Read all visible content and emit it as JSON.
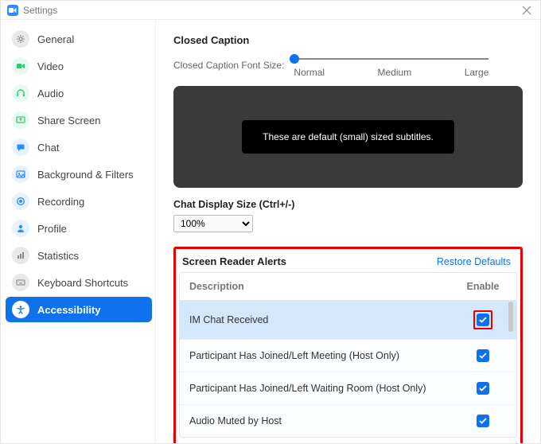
{
  "window": {
    "title": "Settings"
  },
  "sidebar": {
    "items": [
      {
        "label": "General",
        "icon": "gear-icon",
        "bg": "#e9e9e9",
        "fg": "#888"
      },
      {
        "label": "Video",
        "icon": "video-icon",
        "bg": "#e7faef",
        "fg": "#2ecc71"
      },
      {
        "label": "Audio",
        "icon": "headphones-icon",
        "bg": "#e7faef",
        "fg": "#2ecc71"
      },
      {
        "label": "Share Screen",
        "icon": "share-screen-icon",
        "bg": "#e7faef",
        "fg": "#2ecc71"
      },
      {
        "label": "Chat",
        "icon": "chat-icon",
        "bg": "#e7f2ff",
        "fg": "#2d8cff"
      },
      {
        "label": "Background & Filters",
        "icon": "background-icon",
        "bg": "#e7f2ff",
        "fg": "#2d8cff"
      },
      {
        "label": "Recording",
        "icon": "recording-icon",
        "bg": "#e7f2ff",
        "fg": "#2d8cff"
      },
      {
        "label": "Profile",
        "icon": "profile-icon",
        "bg": "#e7f2ff",
        "fg": "#2d8cff"
      },
      {
        "label": "Statistics",
        "icon": "stats-icon",
        "bg": "#e9e9e9",
        "fg": "#888"
      },
      {
        "label": "Keyboard Shortcuts",
        "icon": "keyboard-icon",
        "bg": "#e9e9e9",
        "fg": "#888"
      },
      {
        "label": "Accessibility",
        "icon": "accessibility-icon",
        "bg": "#ffffff",
        "fg": "#0e72ed",
        "active": true
      }
    ]
  },
  "caption": {
    "section_title": "Closed Caption",
    "font_label": "Closed Caption Font Size:",
    "ticks": [
      "Normal",
      "Medium",
      "Large"
    ],
    "preview_text": "These are default (small) sized subtitles."
  },
  "chat_size": {
    "label": "Chat Display Size (Ctrl+/-)",
    "value": "100%"
  },
  "alerts": {
    "title": "Screen Reader Alerts",
    "restore": "Restore Defaults",
    "col_desc": "Description",
    "col_enable": "Enable",
    "rows": [
      {
        "desc": "IM Chat Received",
        "checked": true,
        "highlight": true,
        "chk_outline": true
      },
      {
        "desc": "Participant Has Joined/Left Meeting (Host Only)",
        "checked": true
      },
      {
        "desc": "Participant Has Joined/Left Waiting Room (Host Only)",
        "checked": true
      },
      {
        "desc": "Audio Muted by Host",
        "checked": true
      }
    ]
  }
}
